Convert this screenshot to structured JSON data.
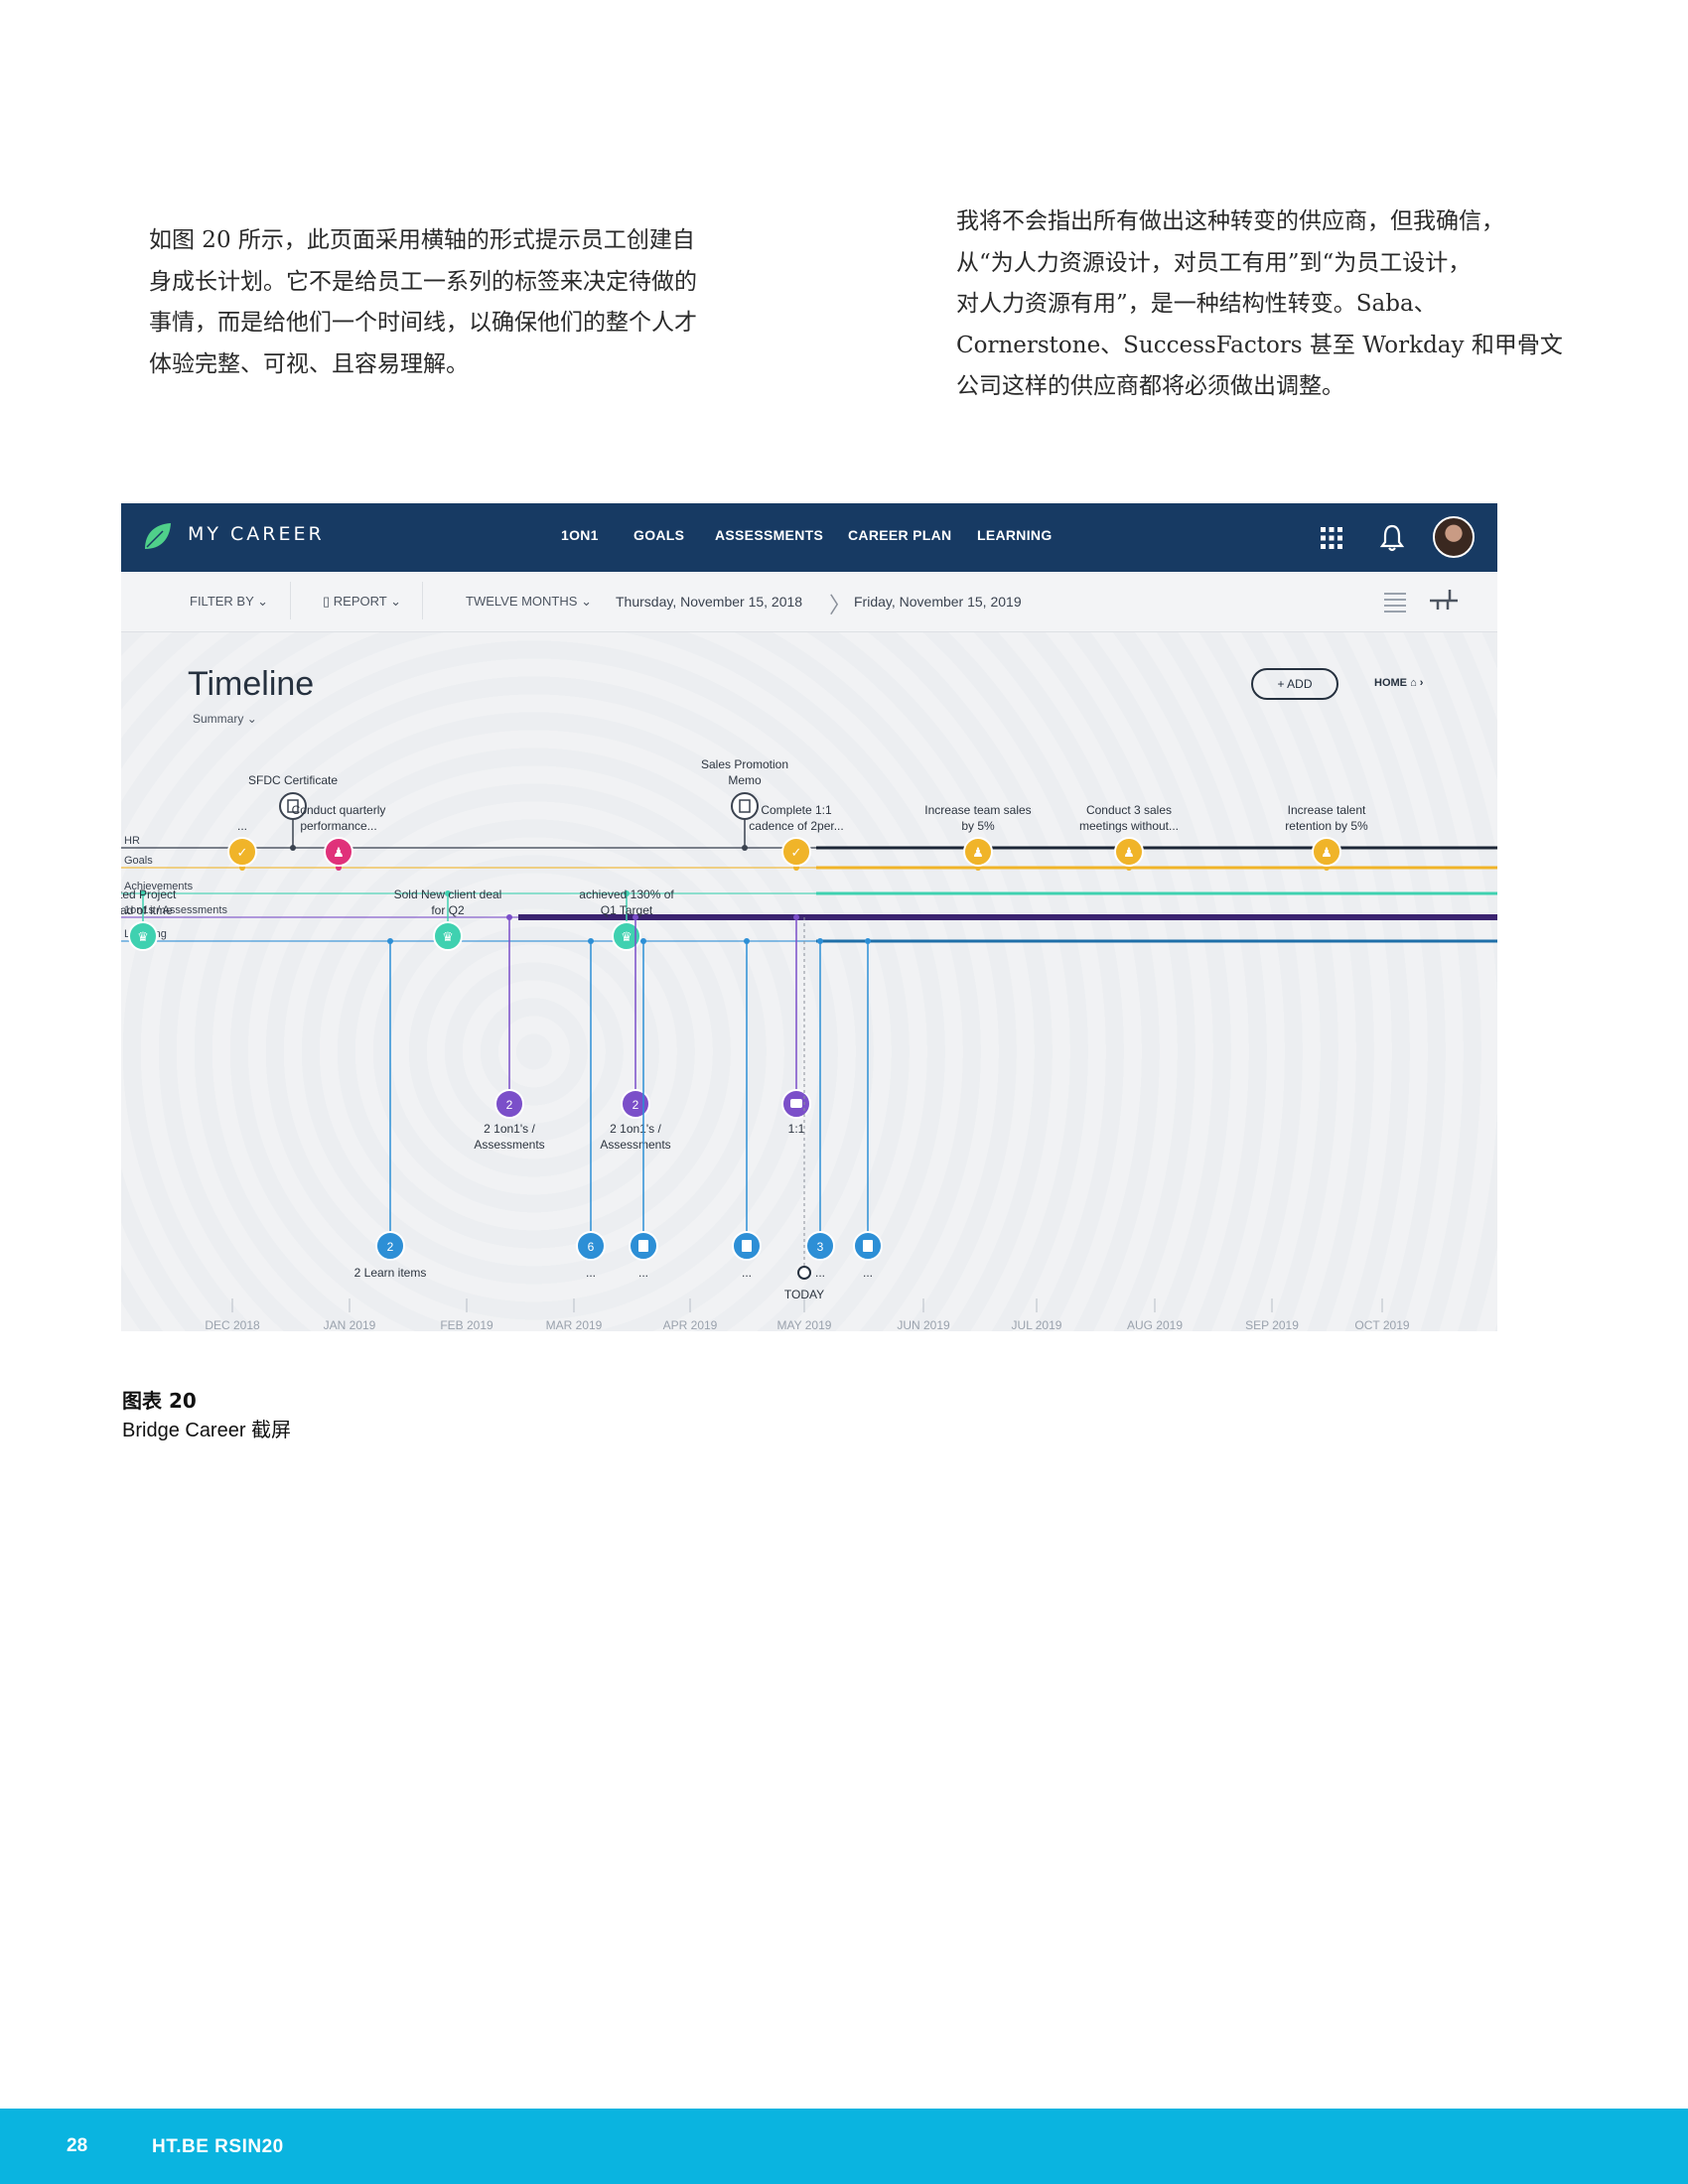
{
  "paragraphs": {
    "left": [
      "如图 20 所示，此页面采用横轴的形式提示员工创建自",
      "身成长计划。它不是给员工一系列的标签来决定待做的",
      "事情，而是给他们一个时间线，以确保他们的整个人才",
      "体验完整、可视、且容易理解。"
    ],
    "right": [
      "我将不会指出所有做出这种转变的供应商，但我确信，",
      "从“为人力资源设计，对员工有用”到“为员工设计，",
      "对人力资源有用”，是一种结构性转变。Saba、",
      "Cornerstone、SuccessFactors 甚至 Workday 和甲骨文",
      "公司这样的供应商都将必须做出调整。"
    ]
  },
  "app": {
    "title": "MY CAREER",
    "nav": [
      "1ON1",
      "GOALS",
      "ASSESSMENTS",
      "CAREER PLAN",
      "LEARNING"
    ],
    "filter_by": "FILTER BY",
    "report": "REPORT",
    "range": "TWELVE MONTHS",
    "date_start": "Thursday, November 15, 2018",
    "date_end": "Friday, November 15, 2019",
    "page_title": "Timeline",
    "summary": "Summary",
    "add_label": "+ ADD",
    "home_label": "HOME"
  },
  "timeline": {
    "lanes": [
      "HR",
      "Goals",
      "Achievements",
      "1on1s / Assessments",
      "Learning"
    ],
    "lane_colors": {
      "HR": "#1c2636",
      "Goals": "#f0b429",
      "Achievements": "#3fd1b0",
      "1on1s / Assessments": "#7b4fc9",
      "Learning": "#2d8fd6"
    },
    "months": [
      "DEC 2018",
      "JAN 2019",
      "FEB 2019",
      "MAR 2019",
      "APR 2019",
      "MAY 2019",
      "JUN 2019",
      "JUL 2019",
      "AUG 2019",
      "SEP 2019",
      "OCT 2019"
    ],
    "today_label": "TODAY",
    "events_above": [
      {
        "lane": "HR",
        "icon": "document-icon",
        "label": [
          "SFDC Certificate"
        ]
      },
      {
        "lane": "Goals",
        "icon": "check-icon",
        "label": [
          "..."
        ]
      },
      {
        "lane": "Goals",
        "icon": "person-icon",
        "color": "#e0317a",
        "label": [
          "Conduct quarterly",
          "performance..."
        ]
      },
      {
        "lane": "Achievements",
        "icon": "trophy-icon",
        "label": [
          "leted Project",
          "ead of itme"
        ]
      },
      {
        "lane": "Achievements",
        "icon": "trophy-icon",
        "label": [
          "Sold New client deal",
          "for Q2"
        ]
      },
      {
        "lane": "Achievements",
        "icon": "trophy-icon",
        "label": [
          "achieved 130% of",
          "Q1 Target"
        ]
      },
      {
        "lane": "HR",
        "icon": "document-icon",
        "label": [
          "Sales Promotion",
          "Memo"
        ]
      },
      {
        "lane": "Goals",
        "icon": "check-icon",
        "label": [
          "Complete 1:1",
          "cadence of 2per..."
        ]
      },
      {
        "lane": "Goals",
        "icon": "person-icon",
        "label": [
          "Increase team sales",
          "by 5%"
        ]
      },
      {
        "lane": "Goals",
        "icon": "person-icon",
        "label": [
          "Conduct 3 sales",
          "meetings without..."
        ]
      },
      {
        "lane": "Goals",
        "icon": "person-icon",
        "label": [
          "Increase talent",
          "retention by 5%"
        ]
      }
    ],
    "events_assess": [
      {
        "badge": "2",
        "label": [
          "2 1on1's /",
          "Assessments"
        ]
      },
      {
        "badge": "2",
        "label": [
          "2 1on1's /",
          "Assessments"
        ]
      },
      {
        "badge": "chat-icon",
        "label": [
          "1:1"
        ]
      }
    ],
    "events_learning": [
      {
        "badge": "2",
        "label": "2 Learn items"
      },
      {
        "badge": "6",
        "label": "..."
      },
      {
        "badge": "book-icon",
        "label": "..."
      },
      {
        "badge": "book-icon",
        "label": "..."
      },
      {
        "badge": "3",
        "label": "..."
      },
      {
        "badge": "book-icon",
        "label": "..."
      }
    ]
  },
  "figure": {
    "label": "图表 20",
    "caption": "Bridge Career 截屏"
  },
  "footer": {
    "page_number": "28",
    "title": "HT.BE RSIN20"
  }
}
